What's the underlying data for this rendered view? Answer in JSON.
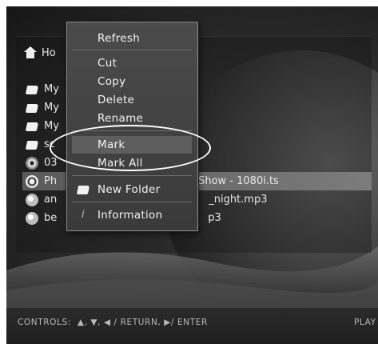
{
  "home": {
    "label": "Ho"
  },
  "files": [
    {
      "icon": "folder-icon",
      "name": "My"
    },
    {
      "icon": "folder-icon",
      "name": "My"
    },
    {
      "icon": "folder-icon",
      "name": "My"
    },
    {
      "icon": "folder-icon",
      "name": "sc"
    },
    {
      "icon": "disc-icon",
      "name": "03"
    },
    {
      "icon": "film-icon",
      "name": "Ph",
      "suffix": "Show - 1080i.ts",
      "selected": true
    },
    {
      "icon": "music-icon",
      "name": "an",
      "suffix": "_night.mp3"
    },
    {
      "icon": "music-icon",
      "name": "be",
      "suffix": "p3"
    }
  ],
  "context_menu": {
    "items": [
      {
        "label": "Refresh"
      },
      {
        "label": "Cut"
      },
      {
        "label": "Copy"
      },
      {
        "label": "Delete"
      },
      {
        "label": "Rename"
      },
      {
        "label": "Mark",
        "highlighted": true
      },
      {
        "label": "Mark All"
      },
      {
        "label": "New Folder",
        "icon": "folder-icon"
      },
      {
        "label": "Information",
        "icon": "info-icon"
      }
    ]
  },
  "footer": {
    "controls_label": "CONTROLS:",
    "controls_keys": "▲, ▼, ◀ / RETURN, ▶/ ENTER",
    "right_label": "PLAY"
  },
  "colors": {
    "menu_bg": "#444444",
    "highlight": "#5e5e5e",
    "selected_row": "#6e6e6e",
    "text": "#f2f2f2"
  }
}
